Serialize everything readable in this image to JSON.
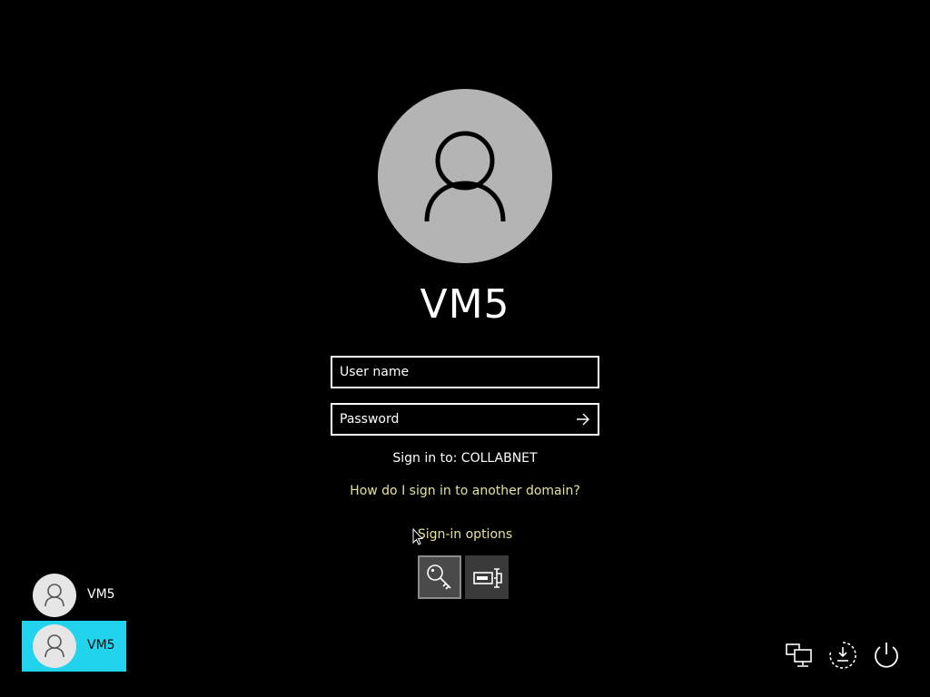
{
  "login": {
    "display_name": "VM5",
    "username_placeholder": "User name",
    "password_placeholder": "Password",
    "sign_in_to": "Sign in to: COLLABNET",
    "domain_help_link": "How do I sign in to another domain?",
    "sign_in_options": "Sign-in options"
  },
  "sign_in_methods": [
    {
      "icon": "key-icon",
      "label": "Password",
      "selected": true
    },
    {
      "icon": "smart-card-icon",
      "label": "Smart card",
      "selected": false
    }
  ],
  "user_list": [
    {
      "name": "VM5",
      "selected": false
    },
    {
      "name": "VM5",
      "selected": true
    }
  ],
  "system_icons": [
    "network-icon",
    "ease-of-access-icon",
    "power-icon"
  ],
  "colors": {
    "background": "#000000",
    "link": "#e6e29b",
    "selected_user": "#22d3ee",
    "avatar_big": "#b4b4b4"
  }
}
